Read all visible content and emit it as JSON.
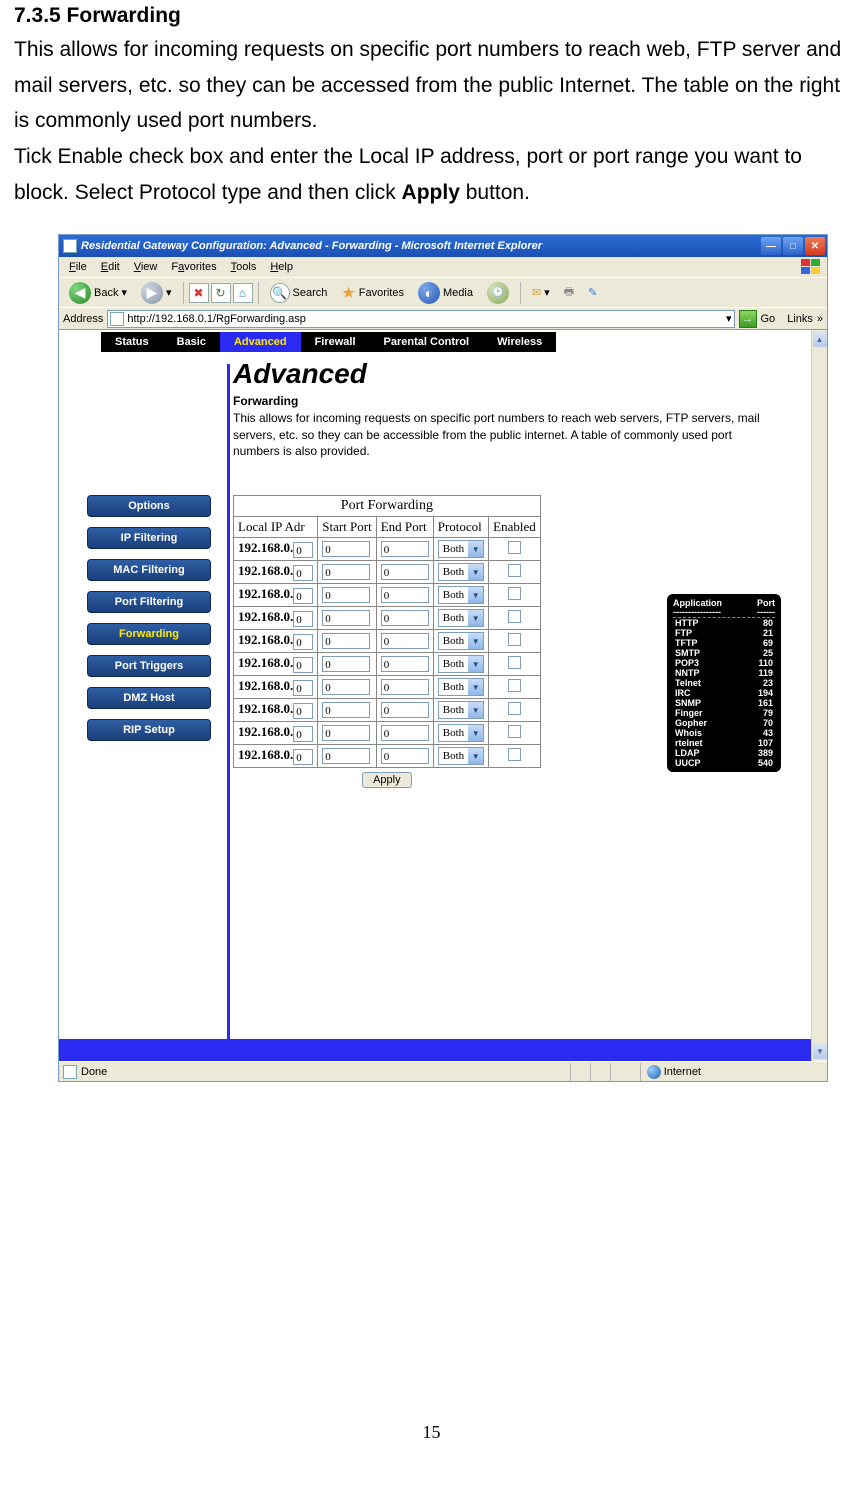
{
  "doc": {
    "heading": "7.3.5 Forwarding",
    "para1": "This allows for incoming requests on specific port numbers to reach web, FTP server and mail servers, etc. so they can be accessed from the public Internet. The table on the right is commonly used port numbers.",
    "para2a": "Tick Enable check box and enter the Local IP address, port or port range you want to block. Select Protocol type and then click ",
    "para2b": "Apply",
    "para2c": " button.",
    "page_number": "15"
  },
  "ie": {
    "title": "Residential Gateway Configuration: Advanced - Forwarding - Microsoft Internet Explorer",
    "menus": [
      "File",
      "Edit",
      "View",
      "Favorites",
      "Tools",
      "Help"
    ],
    "toolbar": {
      "back": "Back",
      "search": "Search",
      "favorites": "Favorites",
      "media": "Media"
    },
    "address_label": "Address",
    "url": "http://192.168.0.1/RgForwarding.asp",
    "go": "Go",
    "links": "Links",
    "status_left": "Done",
    "status_right": "Internet"
  },
  "nav": {
    "tabs": [
      "Status",
      "Basic",
      "Advanced",
      "Firewall",
      "Parental Control",
      "Wireless"
    ],
    "active_index": 2
  },
  "page": {
    "title": "Advanced",
    "subtitle": "Forwarding",
    "desc": "This allows for incoming requests on specific port numbers to reach  web servers, FTP servers, mail servers, etc. so they can be accessible from the public internet.  A table of commonly used port numbers is also provided."
  },
  "sidebar": [
    {
      "label": "Options"
    },
    {
      "label": "IP Filtering"
    },
    {
      "label": "MAC Filtering"
    },
    {
      "label": "Port Filtering"
    },
    {
      "label": "Forwarding",
      "active": true
    },
    {
      "label": "Port Triggers"
    },
    {
      "label": "DMZ Host"
    },
    {
      "label": "RIP Setup"
    }
  ],
  "table": {
    "caption": "Port Forwarding",
    "headers": [
      "Local IP Adr",
      "Start Port",
      "End Port",
      "Protocol",
      "Enabled"
    ],
    "ip_prefix": "192.168.0.",
    "ip_last": "0",
    "port_value": "0",
    "protocol_value": "Both",
    "row_count": 10,
    "apply": "Apply"
  },
  "ports": {
    "header_app": "Application",
    "header_port": "Port",
    "rows": [
      {
        "app": "HTTP",
        "port": "80"
      },
      {
        "app": "FTP",
        "port": "21"
      },
      {
        "app": "TFTP",
        "port": "69"
      },
      {
        "app": "SMTP",
        "port": "25"
      },
      {
        "app": "POP3",
        "port": "110"
      },
      {
        "app": "NNTP",
        "port": "119"
      },
      {
        "app": "Telnet",
        "port": "23"
      },
      {
        "app": "IRC",
        "port": "194"
      },
      {
        "app": "SNMP",
        "port": "161"
      },
      {
        "app": "Finger",
        "port": "79"
      },
      {
        "app": "Gopher",
        "port": "70"
      },
      {
        "app": "Whois",
        "port": "43"
      },
      {
        "app": "rtelnet",
        "port": "107"
      },
      {
        "app": "LDAP",
        "port": "389"
      },
      {
        "app": "UUCP",
        "port": "540"
      }
    ]
  }
}
